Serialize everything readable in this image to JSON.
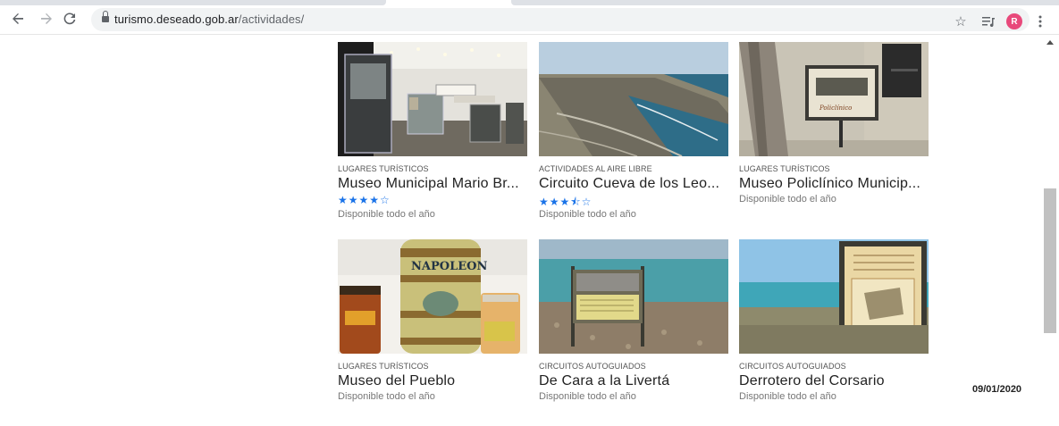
{
  "browser": {
    "url_host": "turismo.deseado.gob.ar",
    "url_path": "/actividades/",
    "profile_initial": "R",
    "icons": [
      "back-arrow-icon",
      "forward-arrow-icon",
      "reload-icon",
      "lock-icon",
      "star-bookmark-icon",
      "playlist-icon",
      "more-vert-icon"
    ]
  },
  "colors": {
    "accent_stars": "#1a73e8",
    "avatar": "#e8497b"
  },
  "cards": [
    {
      "category": "LUGARES TURÍSTICOS",
      "title": "Museo Municipal Mario Br...",
      "stars": "★★★★☆",
      "rating": 4,
      "availability": "Disponible todo el año"
    },
    {
      "category": "ACTIVIDADES AL AIRE LIBRE",
      "title": "Circuito Cueva de los Leo...",
      "stars": "★★★⯪☆",
      "rating": 3.5,
      "availability": "Disponible todo el año"
    },
    {
      "category": "LUGARES TURÍSTICOS",
      "title": "Museo Policlínico Municip...",
      "stars": "",
      "rating": null,
      "availability": "Disponible todo el año"
    },
    {
      "category": "LUGARES TURÍSTICOS",
      "title": "Museo del Pueblo",
      "stars": "",
      "rating": null,
      "availability": "Disponible todo el año"
    },
    {
      "category": "CIRCUITOS AUTOGUIADOS",
      "title": "De Cara a la Livertá",
      "stars": "",
      "rating": null,
      "availability": "Disponible todo el año"
    },
    {
      "category": "CIRCUITOS AUTOGUIADOS",
      "title": "Derrotero del Corsario",
      "stars": "",
      "rating": null,
      "availability": "Disponible todo el año"
    }
  ],
  "date_stamp": "09/01/2020"
}
